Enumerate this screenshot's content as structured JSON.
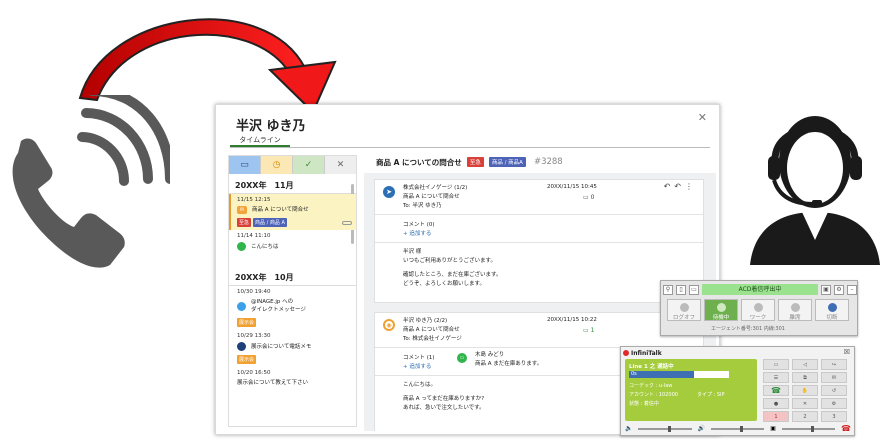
{
  "colors": {
    "accent_green": "#2e7d32",
    "tag_red": "#d9403a",
    "tag_blue": "#4d63b8",
    "tag_orange": "#f0a131",
    "arrow_red": "#e01818"
  },
  "card": {
    "customer_name": "半沢 ゆき乃",
    "tab_label": "タイムライン",
    "close_icon": "close-icon"
  },
  "timeline": {
    "toolbar": [
      "inbox-icon",
      "clock-icon",
      "check-icon",
      "close-icon"
    ],
    "groups": [
      {
        "month": "20XX年　11月",
        "items": [
          {
            "time": "11/15 12:15",
            "icon": "mail-icon",
            "text": "商品 A について問合せ",
            "tags": [
              "至急",
              "商品 / 商品 A"
            ]
          },
          {
            "time": "11/14 11:10",
            "icon": "line-icon",
            "text": "こんにちは",
            "tags": []
          }
        ]
      },
      {
        "month": "20XX年　10月",
        "items": [
          {
            "time": "10/30 19:40",
            "icon": "twitter-icon",
            "text_line1": "@INAGE.jp への",
            "text_line2": "ダイレクトメッセージ",
            "tags": [
              "展示会"
            ]
          },
          {
            "time": "10/29 13:30",
            "icon": "phone-icon",
            "text": "展示会について電話メモ",
            "tags": [
              "展示会"
            ]
          },
          {
            "time": "10/20 16:50",
            "icon": "mail-icon",
            "text": "展示会について教えて下さい",
            "tags": []
          }
        ]
      }
    ]
  },
  "detail": {
    "subject": "商品 A についての問合せ",
    "tags": [
      "至急",
      "商品 / 商品A"
    ],
    "ticket": "#3288",
    "messages": [
      {
        "from": "株式会社イノゲージ (1/2)",
        "subject": "商品 A について問合せ",
        "to": "To: 半沢 ゆき乃",
        "date": "20XX/11/15 10:45",
        "comment_count": "0",
        "comment_label": "コメント (0)",
        "add_label": "+ 追加する",
        "body": [
          "半沢 様",
          "いつもご利用ありがとうございます。",
          "",
          "確認したところ、まだ在庫ございます。",
          "どうぞ、よろしくお願いします。"
        ]
      },
      {
        "from": "半沢 ゆき乃 (2/2)",
        "subject": "商品 A について問合せ",
        "to": "To: 株式会社イノゲージ",
        "date": "20XX/11/15 10:22",
        "comment_count": "1",
        "comment_label": "コメント (1)",
        "add_label": "+ 追加する",
        "comment_author": "木島 みどり",
        "comment_text": "商品 A まだ在庫あります。",
        "body": [
          "こんにちは。",
          "",
          "商品 A ってまだ在庫ありますか?",
          "あれば、急いで注文したいです。"
        ]
      }
    ]
  },
  "acd": {
    "status": "ACD着信呼出中",
    "buttons": [
      "ログオフ",
      "待機中",
      "ワーク",
      "離席",
      "切断"
    ],
    "footer": "エージェント番号:301 内線:301"
  },
  "infinitalk": {
    "title": "InfiniTalk",
    "line_status": "Line 1 之 通話中",
    "bar_label": "0s",
    "codec": "コーデック : u-law",
    "type": "タイプ : SIP",
    "account": "アカウント : 102000",
    "state": "状態 : 着信中",
    "keys": [
      "1",
      "2",
      "3"
    ]
  }
}
